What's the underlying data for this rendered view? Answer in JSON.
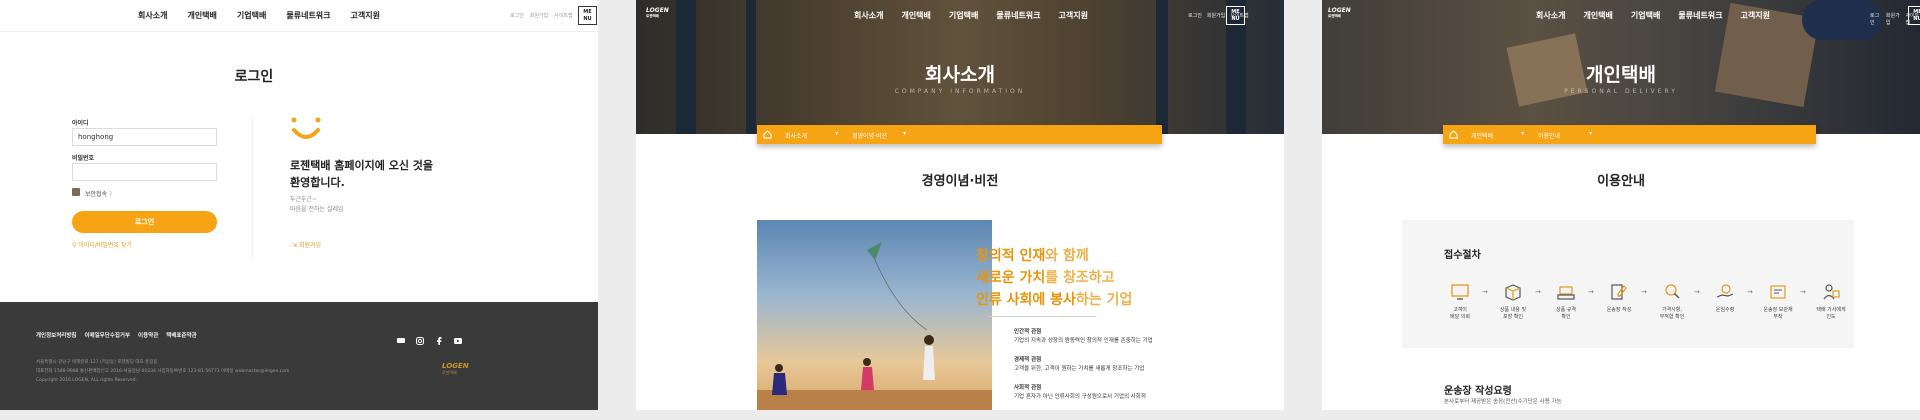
{
  "panel1": {
    "nav": [
      "회사소개",
      "개인택배",
      "기업택배",
      "물류네트워크",
      "고객지원"
    ],
    "util": [
      "로그인",
      "회원가입",
      "사이트맵"
    ],
    "menu_btn": [
      "ME",
      "NU"
    ],
    "title": "로그인",
    "id_label": "아이디",
    "id_value": "honghong",
    "pw_label": "비밀번호",
    "secure_label": "보안접속",
    "secure_help": "?",
    "login_btn": "로그인",
    "find_link": "아이디/비밀번호 찾기",
    "welcome": [
      "로젠택배 홈페이지에 오신 것을",
      "환영합니다."
    ],
    "slogan": [
      "두근두근~",
      "마음을 전하는 설레임"
    ],
    "join_link": "회원가입",
    "footer_links": [
      "개인정보처리방침",
      "이메일무단수집거부",
      "이용약관",
      "택배표준약관"
    ],
    "footer_info": [
      "서울특별시 강남구 테헤란로 127 (역삼동) 로젠빌딩 대표 홍길동",
      "대표전화 1588-9988  통신판매업신고 2016-서울강남-01234  사업자등록번호 123-81-56773  이메일 webmaster@ilogen.com",
      "Copyright 2016 LOGEN, ALL rights Reserved."
    ],
    "footer_logo": "LOGEN",
    "footer_logo_sub": "로젠택배"
  },
  "panel2": {
    "logo": "LOGEN",
    "logo_sub": "로젠택배",
    "nav": [
      "회사소개",
      "개인택배",
      "기업택배",
      "물류네트워크",
      "고객지원"
    ],
    "util": [
      "로그인",
      "회원가입",
      "사이트맵"
    ],
    "menu_btn": [
      "ME",
      "NU"
    ],
    "hero_title": "회사소개",
    "hero_sub": "COMPANY INFORMATION",
    "bar": [
      "회사소개",
      "경영이념·비전"
    ],
    "section_title": "경영이념·비전",
    "vision": [
      {
        "hl": "창의적 인재",
        "rest": "와 함께"
      },
      {
        "hl": "새로운 가치",
        "rest": "를 창조하고"
      },
      {
        "hl": "인류 사회에 봉사",
        "rest": "하는 기업"
      }
    ],
    "items": [
      {
        "t": "인간적 관점",
        "d": "기업의 지속과 성장의 원동력인 창의적 인재를 존중하는 기업"
      },
      {
        "t": "경제적 관점",
        "d": "고객을 위한, 고객이 원하는 가치를 새롭게 창조하는 기업"
      },
      {
        "t": "사회적 관점",
        "d": "기업 혼자가 아닌 인류사회의 구성원으로서 기업의 사회적"
      }
    ]
  },
  "panel3": {
    "logo": "LOGEN",
    "logo_sub": "로젠택배",
    "nav": [
      "회사소개",
      "개인택배",
      "기업택배",
      "물류네트워크",
      "고객지원"
    ],
    "util": [
      "로그인",
      "회원가입",
      "사이트맵"
    ],
    "menu_btn": [
      "ME",
      "NU"
    ],
    "hero_title": "개인택배",
    "hero_sub": "PERSONAL DELIVERY",
    "bar": [
      "개인택배",
      "이용안내"
    ],
    "section_title": "이용안내",
    "steps_title": "접수절차",
    "steps": [
      [
        "고객이",
        "배달 의뢰"
      ],
      [
        "상품 내용 및",
        "포장 확인"
      ],
      [
        "상품 규격",
        "확인"
      ],
      [
        "운송장 작성",
        ""
      ],
      [
        "가격사항,",
        "부적합 확인"
      ],
      [
        "운임수령",
        ""
      ],
      [
        "운송장 보관재",
        "부착"
      ],
      [
        "택배 기사에게",
        "인도"
      ]
    ],
    "waybill_title": "운송장 작성요령",
    "waybill_sub": "본사로부터 제공받은 송장(전산)수기단은 사용 가능"
  }
}
